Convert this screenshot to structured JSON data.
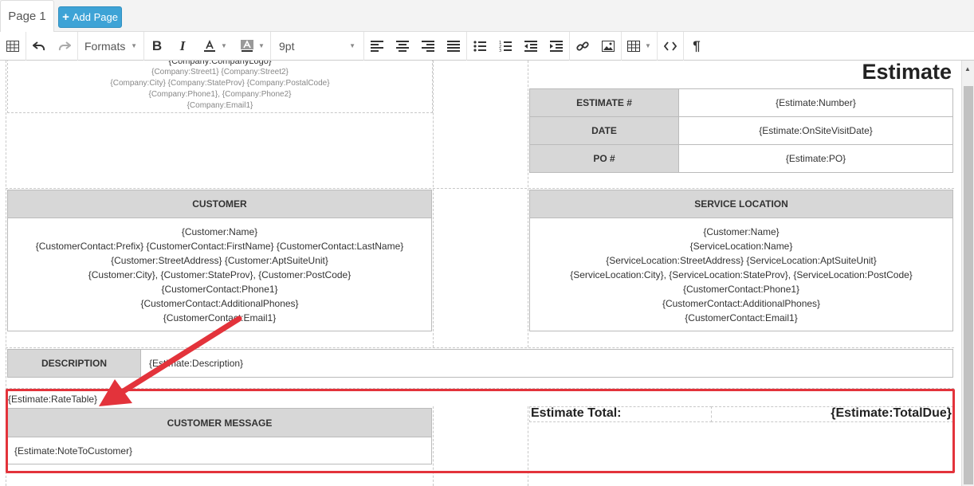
{
  "tabs": {
    "page_label": "Page 1",
    "add_label": "Add Page"
  },
  "toolbar": {
    "formats_label": "Formats",
    "font_size": "9pt"
  },
  "company": {
    "logo": "{Company:CompanyLogo}",
    "street": "{Company:Street1} {Company:Street2}",
    "city": "{Company:City} {Company:StateProv} {Company:PostalCode}",
    "phone": "{Company:Phone1}, {Company:Phone2}",
    "email": "{Company:Email1}"
  },
  "estimate": {
    "title": "Estimate",
    "rows": [
      {
        "label": "ESTIMATE #",
        "value": "{Estimate:Number}"
      },
      {
        "label": "DATE",
        "value": "{Estimate:OnSiteVisitDate}"
      },
      {
        "label": "PO #",
        "value": "{Estimate:PO}"
      }
    ]
  },
  "customer": {
    "header": "CUSTOMER",
    "lines": [
      "{Customer:Name}",
      "{CustomerContact:Prefix} {CustomerContact:FirstName} {CustomerContact:LastName}",
      "{Customer:StreetAddress} {Customer:AptSuiteUnit}",
      "{Customer:City}, {Customer:StateProv}, {Customer:PostCode}",
      "{CustomerContact:Phone1}",
      "{CustomerContact:AdditionalPhones}",
      "{CustomerContact:Email1}"
    ]
  },
  "service_location": {
    "header": "SERVICE LOCATION",
    "lines": [
      "{Customer:Name}",
      "{ServiceLocation:Name}",
      "{ServiceLocation:StreetAddress} {ServiceLocation:AptSuiteUnit}",
      "{ServiceLocation:City}, {ServiceLocation:StateProv}, {ServiceLocation:PostCode}",
      "{CustomerContact:Phone1}",
      "{CustomerContact:AdditionalPhones}",
      "{CustomerContact:Email1}"
    ]
  },
  "description": {
    "label": "DESCRIPTION",
    "value": "{Estimate:Description}"
  },
  "rate_table": "{Estimate:RateTable}",
  "customer_message": {
    "header": "CUSTOMER MESSAGE",
    "value": "{Estimate:NoteToCustomer}"
  },
  "total": {
    "label": "Estimate Total:",
    "value": "{Estimate:TotalDue}"
  },
  "colors": {
    "add_button": "#3ea3d6",
    "highlight": "#e3333b",
    "header_fill": "#d7d7d7"
  }
}
